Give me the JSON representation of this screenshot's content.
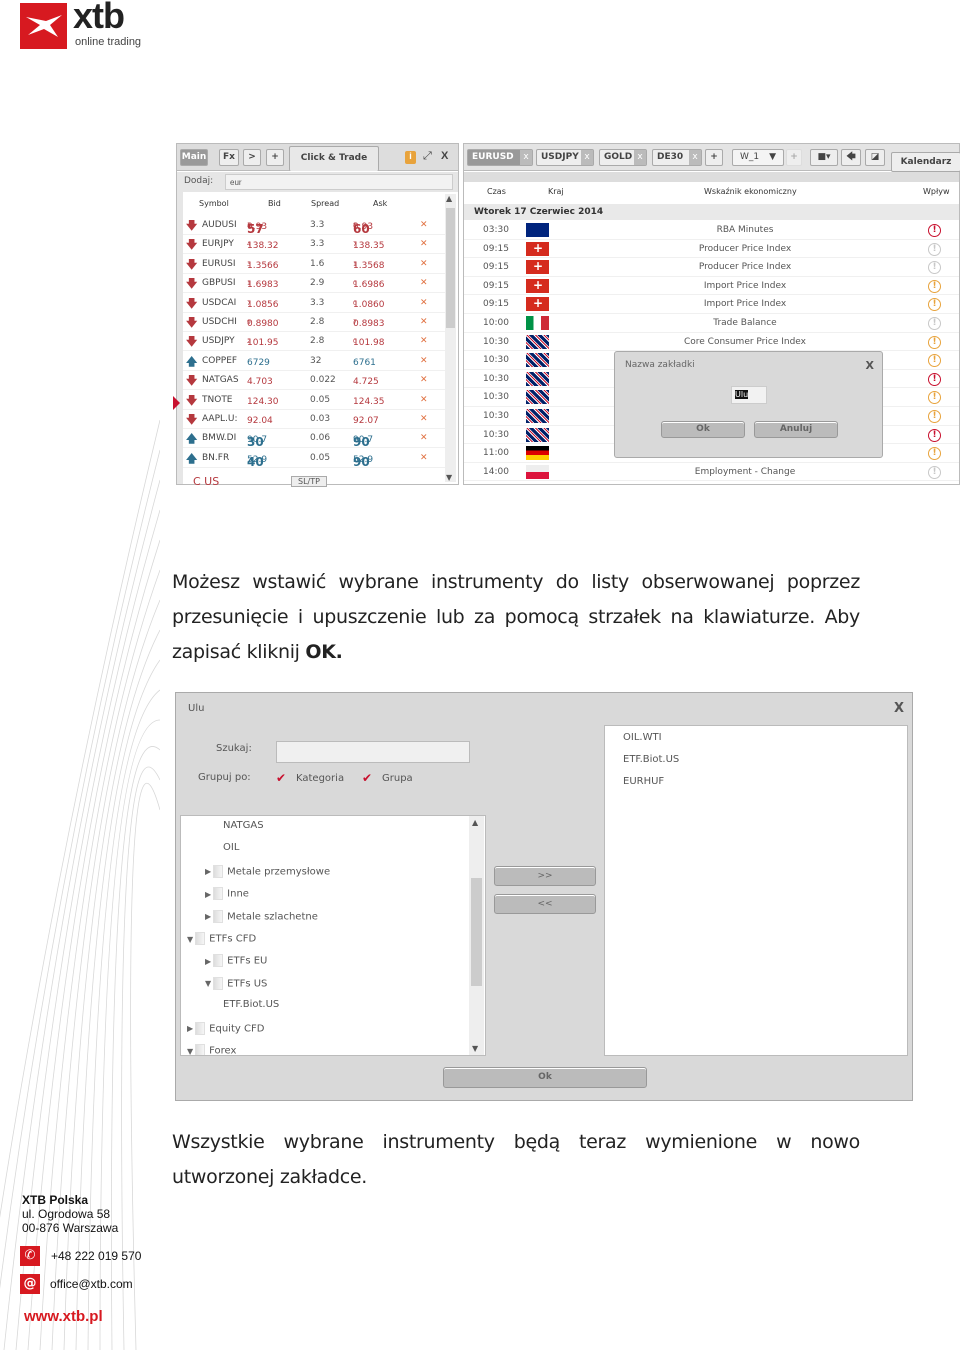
{
  "brand": {
    "name": "xtb",
    "tagline": "online trading",
    "color": "#d71920"
  },
  "watchlist": {
    "tabs": [
      "Main",
      "Fx",
      ">",
      "+"
    ],
    "click_trade": "Click & Trade",
    "add_label": "Dodaj:",
    "add_value": "eur",
    "headers": [
      "Symbol",
      "Bid",
      "Spread",
      "Ask"
    ],
    "rows": [
      {
        "dir": "down",
        "symbol": "AUDUSI",
        "bid": [
          "0.93",
          "57",
          "3"
        ],
        "spread": "3.3",
        "ask": [
          "0.93",
          "60",
          "8"
        ]
      },
      {
        "dir": "down",
        "symbol": "EURJPY",
        "bid": [
          "138.32",
          "",
          "4"
        ],
        "spread": "3.3",
        "ask": [
          "138.35",
          "",
          "7"
        ]
      },
      {
        "dir": "down",
        "symbol": "EURUSI",
        "bid": [
          "1.3566",
          "",
          "3"
        ],
        "spread": "1.6",
        "ask": [
          "1.3568",
          "",
          "1"
        ]
      },
      {
        "dir": "down",
        "symbol": "GBPUSI",
        "bid": [
          "1.6983",
          "",
          "1"
        ],
        "spread": "2.9",
        "ask": [
          "1.6986",
          "",
          "0"
        ]
      },
      {
        "dir": "down",
        "symbol": "USDCAI",
        "bid": [
          "1.0856",
          "",
          "7"
        ],
        "spread": "3.3",
        "ask": [
          "1.0860",
          "",
          "0"
        ]
      },
      {
        "dir": "down",
        "symbol": "USDCHI",
        "bid": [
          "0.8980",
          "",
          "9"
        ],
        "spread": "2.8",
        "ask": [
          "0.8983",
          "",
          "7"
        ]
      },
      {
        "dir": "down",
        "symbol": "USDJPY",
        "bid": [
          "101.95",
          "",
          "2"
        ],
        "spread": "2.8",
        "ask": [
          "101.98",
          "",
          "0"
        ]
      },
      {
        "dir": "up",
        "symbol": "COPPEF",
        "bid": [
          "6729",
          "",
          ""
        ],
        "spread": "32",
        "ask": [
          "6761",
          "",
          ""
        ]
      },
      {
        "dir": "down",
        "symbol": "NATGAS",
        "bid": [
          "4.703",
          "",
          ""
        ],
        "spread": "0.022",
        "ask": [
          "4.725",
          "",
          ""
        ]
      },
      {
        "dir": "down",
        "symbol": "TNOTE",
        "bid": [
          "124.30",
          "",
          ""
        ],
        "spread": "0.05",
        "ask": [
          "124.35",
          "",
          ""
        ]
      },
      {
        "dir": "down",
        "symbol": "AAPL.U:",
        "bid": [
          "92.04",
          "",
          ""
        ],
        "spread": "0.03",
        "ask": [
          "92.07",
          "",
          ""
        ]
      },
      {
        "dir": "up",
        "symbol": "BMW.DI",
        "bid": [
          "90.7",
          "30",
          ""
        ],
        "spread": "0.06",
        "ask": [
          "90.7",
          "90",
          ""
        ]
      },
      {
        "dir": "up",
        "symbol": "BN.FR",
        "bid": [
          "52.9",
          "40",
          ""
        ],
        "spread": "0.05",
        "ask": [
          "52.9",
          "90",
          ""
        ]
      }
    ],
    "footer_partial": "C US",
    "sltp": "SL/TP"
  },
  "chart_tabs": [
    "EURUSD",
    "USDJPY",
    "GOLD",
    "DE30"
  ],
  "chart_interval": "W_1",
  "calendar": {
    "tab": "Kalendarz",
    "headers": [
      "Czas",
      "Kraj",
      "Wskaźnik ekonomiczny",
      "Wpływ"
    ],
    "date": "Wtorek 17 Czerwiec 2014",
    "impact_colors": {
      "high": "#c8102e",
      "medium": "#e8a33c",
      "low": "#c8c8c8"
    },
    "rows": [
      {
        "time": "03:30",
        "flag": "au",
        "name": "RBA Minutes",
        "impact": "high"
      },
      {
        "time": "09:15",
        "flag": "ch",
        "name": "Producer Price Index",
        "impact": "low"
      },
      {
        "time": "09:15",
        "flag": "ch",
        "name": "Producer Price Index",
        "impact": "low"
      },
      {
        "time": "09:15",
        "flag": "ch",
        "name": "Import Price Index",
        "impact": "medium"
      },
      {
        "time": "09:15",
        "flag": "ch",
        "name": "Import Price Index",
        "impact": "medium"
      },
      {
        "time": "10:00",
        "flag": "it",
        "name": "Trade Balance",
        "impact": "low"
      },
      {
        "time": "10:30",
        "flag": "gb",
        "name": "Core Consumer Price Index",
        "impact": "medium"
      },
      {
        "time": "10:30",
        "flag": "gb",
        "name": "",
        "impact": "medium"
      },
      {
        "time": "10:30",
        "flag": "gb",
        "name": "",
        "impact": "high"
      },
      {
        "time": "10:30",
        "flag": "gb",
        "name": "",
        "impact": "medium"
      },
      {
        "time": "10:30",
        "flag": "gb",
        "name": "",
        "impact": "medium"
      },
      {
        "time": "10:30",
        "flag": "gb",
        "name": "",
        "impact": "high"
      },
      {
        "time": "11:00",
        "flag": "de",
        "name": "",
        "impact": "medium"
      },
      {
        "time": "14:00",
        "flag": "pl",
        "name": "Employment - Change",
        "impact": "low"
      }
    ]
  },
  "tab_name_dialog": {
    "title": "Nazwa zakładki",
    "value": "Ulu",
    "ok": "Ok",
    "cancel": "Anuluj",
    "close": "X"
  },
  "para1": "Możesz wstawić wybrane instrumenty do listy obserwowanej poprzez przesunięcie i upuszczenie lub za pomocą strzałek na klawiaturze. Aby zapisać kliknij ",
  "para1_bold": "OK.",
  "list_dialog": {
    "title": "Ulu",
    "close": "X",
    "search_label": "Szukaj:",
    "search_value": "",
    "group_label": "Grupuj po:",
    "group_options": [
      "Kategoria",
      "Grupa"
    ],
    "tree": [
      {
        "label": "NATGAS",
        "level": 2,
        "toggle": ""
      },
      {
        "label": "OIL",
        "level": 2,
        "toggle": ""
      },
      {
        "label": "Metale przemysłowe",
        "level": 1,
        "toggle": "▶"
      },
      {
        "label": "Inne",
        "level": 1,
        "toggle": "▶"
      },
      {
        "label": "Metale szlachetne",
        "level": 1,
        "toggle": "▶"
      },
      {
        "label": "ETFs CFD",
        "level": 0,
        "toggle": "▼"
      },
      {
        "label": "ETFs EU",
        "level": 1,
        "toggle": "▶"
      },
      {
        "label": "ETFs US",
        "level": 1,
        "toggle": "▼"
      },
      {
        "label": "ETF.Biot.US",
        "level": 2,
        "toggle": ""
      },
      {
        "label": "Equity CFD",
        "level": 0,
        "toggle": "▶"
      },
      {
        "label": "Forex",
        "level": 0,
        "toggle": "▼"
      }
    ],
    "add": ">>",
    "remove": "<<",
    "selected": [
      "OIL.WTI",
      "ETF.Biot.US",
      "EURHUF"
    ],
    "ok": "Ok"
  },
  "para2": "Wszystkie wybrane instrumenty będą teraz wymienione w nowo utworzonej zakładce.",
  "footer": {
    "company": "XTB Polska",
    "street": "ul. Ogrodowa 58",
    "city": "00-876 Warszawa",
    "phone": "+48 222 019 570",
    "email": "office@xtb.com",
    "website": "www.xtb.pl"
  }
}
